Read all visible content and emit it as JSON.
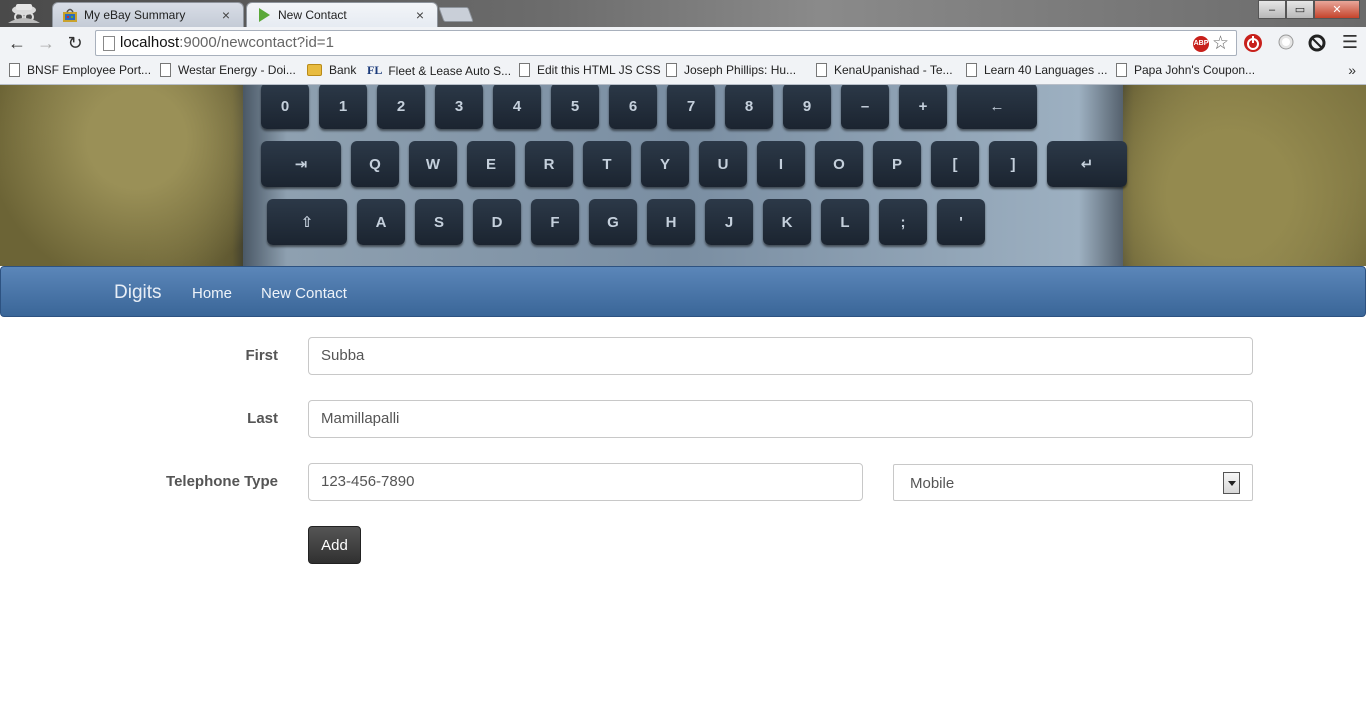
{
  "browser": {
    "tabs": [
      {
        "title": "My eBay Summary",
        "close": "×"
      },
      {
        "title": "New Contact",
        "close": "×"
      }
    ],
    "window_controls": {
      "minimize": "–",
      "maximize": "▭",
      "close": "✕"
    },
    "url_host": "localhost",
    "url_rest": ":9000/newcontact?id=1",
    "abp_label": "ABP",
    "bookmarks": [
      {
        "label": "BNSF Employee Port...",
        "icon": "page-icon"
      },
      {
        "label": "Westar Energy - Doi...",
        "icon": "page-icon"
      },
      {
        "label": "Bank",
        "icon": "folder-icon"
      },
      {
        "label": "Fleet & Lease Auto S...",
        "icon": "fl-icon",
        "icon_text": "FL"
      },
      {
        "label": "Edit this HTML JS CSS",
        "icon": "page-icon"
      },
      {
        "label": "Joseph Phillips: Hu...",
        "icon": "page-icon"
      },
      {
        "label": "KenaUpanishad - Te...",
        "icon": "page-icon"
      },
      {
        "label": "Learn 40 Languages ...",
        "icon": "page-icon"
      },
      {
        "label": "Papa John's Coupon...",
        "icon": "page-icon"
      }
    ],
    "bookmarks_overflow": "»"
  },
  "hero": {
    "keyboard_rows": [
      [
        "0",
        "1",
        "2",
        "3",
        "4",
        "5",
        "6",
        "7",
        "8",
        "9",
        "–",
        "+",
        "←"
      ],
      [
        "⇥",
        "Q",
        "W",
        "E",
        "R",
        "T",
        "Y",
        "U",
        "I",
        "O",
        "P",
        "[",
        "]",
        "↵"
      ],
      [
        "⇧",
        "A",
        "S",
        "D",
        "F",
        "G",
        "H",
        "J",
        "K",
        "L",
        ";",
        "'"
      ]
    ]
  },
  "navbar": {
    "brand": "Digits",
    "links": [
      "Home",
      "New Contact"
    ]
  },
  "form": {
    "first_label": "First",
    "first_value": "Subba",
    "last_label": "Last",
    "last_value": "Mamillapalli",
    "phone_label": "Telephone Type",
    "phone_value": "123-456-7890",
    "type_value": "Mobile",
    "add_label": "Add"
  },
  "colors": {
    "navbar_top": "#5b86b9",
    "navbar_bottom": "#3a6698",
    "button_dark": "#303030"
  }
}
